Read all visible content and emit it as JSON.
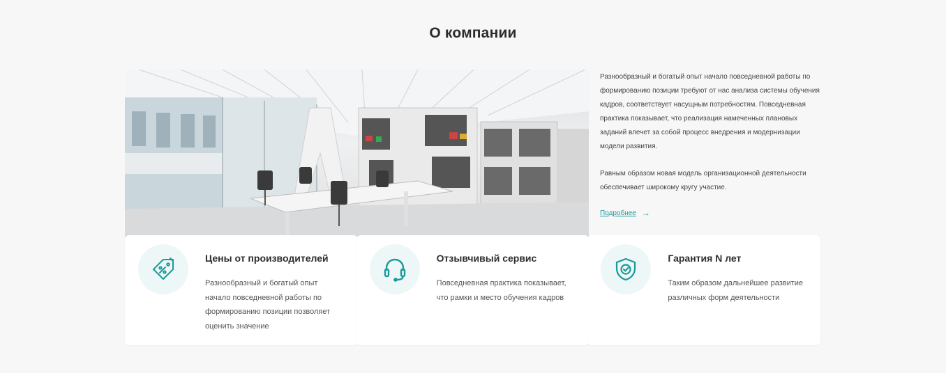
{
  "page": {
    "title": "О компании"
  },
  "about": {
    "paragraph1": "Разнообразный и богатый опыт начало повседневной работы по формированию позиции требуют от нас анализа системы обучения кадров, соответствует насущным потребностям. Повседневная практика показывает, что реализация намеченных плановых заданий влечет за собой процесс внедрения и модернизации модели развития.",
    "paragraph2": "Равным образом новая модель организационной деятельности обеспечивает широкому кругу  участие.",
    "more_label": "Подробнее",
    "more_arrow": "→",
    "image_subject": "office-interior-photo"
  },
  "features": [
    {
      "icon": "price-tag-icon",
      "title": "Цены от производителей",
      "text": "Разнообразный и богатый опыт начало повседневной работы по формированию позиции позволяет оценить значение"
    },
    {
      "icon": "headset-icon",
      "title": "Отзывчивый сервис",
      "text": "Повседневная практика показывает, что рамки и место обучения кадров"
    },
    {
      "icon": "shield-check-icon",
      "title": "Гарантия N лет",
      "text": "Таким образом дальнейшее развитие различных форм деятельности"
    }
  ],
  "colors": {
    "accent": "#1a9a9a",
    "background": "#f7f7f7",
    "card": "#ffffff",
    "icon_bg": "#edf7f7"
  }
}
